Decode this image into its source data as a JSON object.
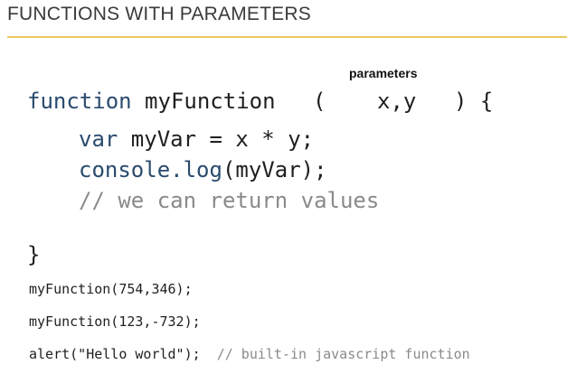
{
  "slide": {
    "title": "FUNCTIONS WITH PARAMETERS",
    "params_label": "parameters"
  },
  "code": {
    "fn_keyword": "function",
    "fn_name": "myFunction",
    "open_paren": "(",
    "params": "x,y",
    "close_paren_brace": ") {",
    "line2_kw": "var",
    "line2_rest": " myVar = x * y;",
    "line3_obj": "console.",
    "line3_method": "log",
    "line3_rest": "(myVar);",
    "line4_comment": "// we can return values",
    "closing_brace": "}",
    "call1": "myFunction(754,346);",
    "call2": "myFunction(123,-732);",
    "call3_code": "alert(\"Hello world\");",
    "call3_comment": "// built-in javascript function"
  },
  "colors": {
    "accent_rule": "#e9c85a",
    "keyword": "#2a4b6e",
    "comment": "#8a8a8a"
  }
}
